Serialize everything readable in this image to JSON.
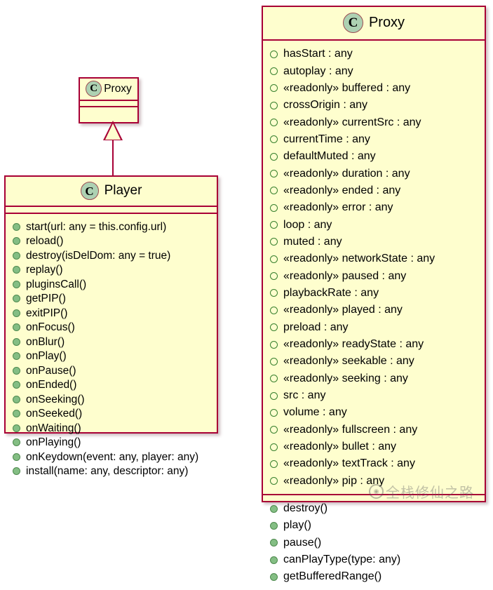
{
  "diagram": {
    "type": "uml-class-diagram",
    "colors": {
      "class_fill": "#FEFECE",
      "class_border": "#A80036",
      "icon_fill": "#ADD1B2",
      "icon_border": "#9B4A52",
      "method_marker": "#84BE84",
      "field_marker_border": "#38812E",
      "page_background": "#FFFFFF"
    },
    "classes": [
      {
        "id": "proxy-super",
        "name": "Proxy",
        "stereotype_icon": "C",
        "attributes": [],
        "methods": [],
        "collapsed": true
      },
      {
        "id": "player-class",
        "name": "Player",
        "stereotype_icon": "C",
        "attributes": [],
        "methods": [
          {
            "visibility": "method",
            "text": "start(url: any = this.config.url)"
          },
          {
            "visibility": "method",
            "text": "reload()"
          },
          {
            "visibility": "method",
            "text": "destroy(isDelDom: any = true)"
          },
          {
            "visibility": "method",
            "text": "replay()"
          },
          {
            "visibility": "method",
            "text": "pluginsCall()"
          },
          {
            "visibility": "method",
            "text": "getPIP()"
          },
          {
            "visibility": "method",
            "text": "exitPIP()"
          },
          {
            "visibility": "method",
            "text": "onFocus()"
          },
          {
            "visibility": "method",
            "text": "onBlur()"
          },
          {
            "visibility": "method",
            "text": "onPlay()"
          },
          {
            "visibility": "method",
            "text": "onPause()"
          },
          {
            "visibility": "method",
            "text": "onEnded()"
          },
          {
            "visibility": "method",
            "text": "onSeeking()"
          },
          {
            "visibility": "method",
            "text": "onSeeked()"
          },
          {
            "visibility": "method",
            "text": "onWaiting()"
          },
          {
            "visibility": "method",
            "text": "onPlaying()"
          },
          {
            "visibility": "method",
            "text": "onKeydown(event: any, player: any)"
          },
          {
            "visibility": "method",
            "text": "install(name: any, descriptor: any)"
          }
        ]
      },
      {
        "id": "proxy-class",
        "name": "Proxy",
        "stereotype_icon": "C",
        "attributes": [
          {
            "visibility": "field",
            "text": "hasStart : any"
          },
          {
            "visibility": "field",
            "text": "autoplay : any"
          },
          {
            "visibility": "field",
            "text": "«readonly» buffered : any"
          },
          {
            "visibility": "field",
            "text": "crossOrigin : any"
          },
          {
            "visibility": "field",
            "text": "«readonly» currentSrc : any"
          },
          {
            "visibility": "field",
            "text": "currentTime : any"
          },
          {
            "visibility": "field",
            "text": "defaultMuted : any"
          },
          {
            "visibility": "field",
            "text": "«readonly» duration : any"
          },
          {
            "visibility": "field",
            "text": "«readonly» ended : any"
          },
          {
            "visibility": "field",
            "text": "«readonly» error : any"
          },
          {
            "visibility": "field",
            "text": "loop : any"
          },
          {
            "visibility": "field",
            "text": "muted : any"
          },
          {
            "visibility": "field",
            "text": "«readonly» networkState : any"
          },
          {
            "visibility": "field",
            "text": "«readonly» paused : any"
          },
          {
            "visibility": "field",
            "text": "playbackRate : any"
          },
          {
            "visibility": "field",
            "text": "«readonly» played : any"
          },
          {
            "visibility": "field",
            "text": "preload : any"
          },
          {
            "visibility": "field",
            "text": "«readonly» readyState : any"
          },
          {
            "visibility": "field",
            "text": "«readonly» seekable : any"
          },
          {
            "visibility": "field",
            "text": "«readonly» seeking : any"
          },
          {
            "visibility": "field",
            "text": "src : any"
          },
          {
            "visibility": "field",
            "text": "volume : any"
          },
          {
            "visibility": "field",
            "text": "«readonly» fullscreen : any"
          },
          {
            "visibility": "field",
            "text": "«readonly» bullet : any"
          },
          {
            "visibility": "field",
            "text": "«readonly» textTrack : any"
          },
          {
            "visibility": "field",
            "text": "«readonly» pip : any"
          }
        ],
        "methods": [
          {
            "visibility": "method",
            "text": "destroy()"
          },
          {
            "visibility": "method",
            "text": "play()"
          },
          {
            "visibility": "method",
            "text": "pause()"
          },
          {
            "visibility": "method",
            "text": "canPlayType(type: any)"
          },
          {
            "visibility": "method",
            "text": "getBufferedRange()"
          }
        ]
      }
    ],
    "relationships": [
      {
        "id": "player-extends-proxy",
        "kind": "generalization",
        "from": "Player",
        "to": "Proxy",
        "arrow": "hollow-triangle"
      }
    ]
  },
  "watermark": {
    "logo_icon": "circle-logo-icon",
    "text": "全栈修仙之路"
  }
}
